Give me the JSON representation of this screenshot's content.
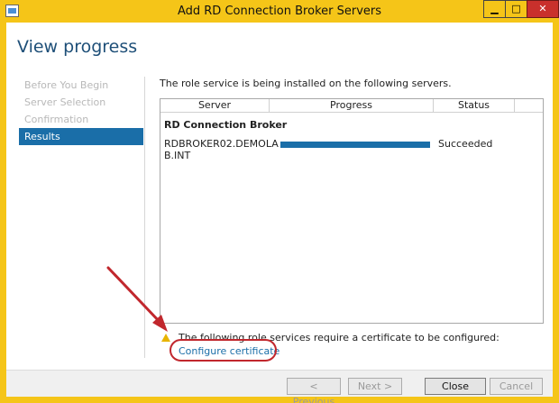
{
  "window": {
    "title": "Add RD Connection Broker Servers",
    "minimize_glyph": "▁",
    "maximize_glyph": "□",
    "close_glyph": "✕"
  },
  "page": {
    "title": "View progress"
  },
  "nav": {
    "items": [
      {
        "label": "Before You Begin",
        "active": false
      },
      {
        "label": "Server Selection",
        "active": false
      },
      {
        "label": "Confirmation",
        "active": false
      },
      {
        "label": "Results",
        "active": true
      }
    ]
  },
  "content": {
    "intro": "The role service is being installed on the following servers.",
    "columns": [
      "Server",
      "Progress",
      "Status"
    ],
    "group_title": "RD Connection Broker",
    "rows": [
      {
        "server": "RDBROKER02.DEMOLAB.INT",
        "progress": 1.0,
        "status": "Succeeded"
      }
    ],
    "notice_text": "The following role services require a certificate to be configured:",
    "notice_link": "Configure certificate"
  },
  "footer": {
    "previous": "< Previous",
    "next": "Next >",
    "close": "Close",
    "cancel": "Cancel"
  },
  "colors": {
    "accent": "#1a6ea8",
    "titlebar": "#f5c518",
    "close_button": "#c9302c",
    "annotation": "#c1272d"
  }
}
